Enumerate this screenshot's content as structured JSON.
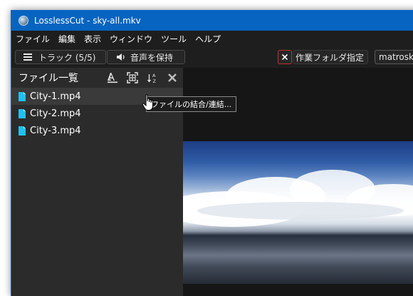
{
  "window": {
    "title": "LosslessCut - sky-all.mkv"
  },
  "menu": [
    "ファイル",
    "編集",
    "表示",
    "ウィンドウ",
    "ツール",
    "ヘルプ"
  ],
  "toolbar": {
    "tracks_label": "トラック (5/5)",
    "keep_audio_label": "音声を保持",
    "output_dir_label": "作業フォルダ指定",
    "format_value": "matroska"
  },
  "sidebar": {
    "title": "ファイル一覧",
    "files": [
      "City-1.mp4",
      "City-2.mp4",
      "City-3.mp4"
    ],
    "selected_index": 0
  },
  "tooltip": {
    "text": "ファイルの結合/連結..."
  },
  "colors": {
    "titlebar": "#0764c0",
    "file_icon": "#20c0f0",
    "close_accent": "#c03030"
  }
}
